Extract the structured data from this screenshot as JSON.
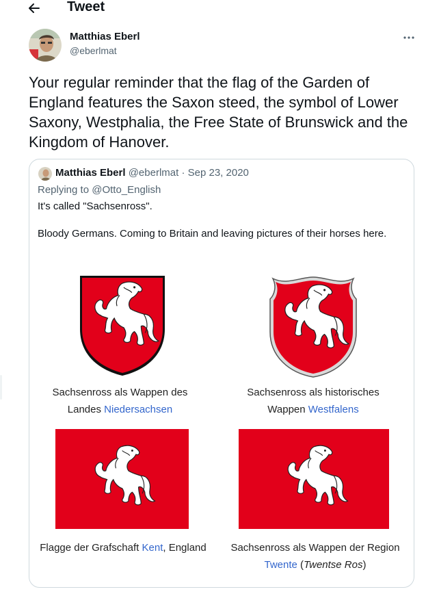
{
  "header": {
    "title": "Tweet"
  },
  "tweet": {
    "author": "Matthias Eberl",
    "handle": "@eberlmat",
    "text": "Your regular reminder that the flag of the Garden of England features the Saxon steed, the symbol of Lower Saxony, Westphalia, the Free State of Brunswick and the Kingdom of Hanover."
  },
  "quote": {
    "author": "Matthias Eberl",
    "handle": "@eberlmat",
    "separator": "·",
    "date": "Sep 23, 2020",
    "replying_to": "Replying to @Otto_English",
    "line1": "It's called \"Sachsenross\".",
    "line2": "Bloody Germans. Coming to Britain and leaving pictures of their horses here.",
    "captions": {
      "c1_a": "Sachsenross als Wappen des",
      "c1_b": "Landes ",
      "c1_link": "Niedersachsen",
      "c2_a": "Sachsenross als historisches",
      "c2_b": "Wappen ",
      "c2_link": "Westfalens",
      "c3_a": "Flagge der Grafschaft ",
      "c3_link": "Kent",
      "c3_b": ", England",
      "c4_a": "Sachsenross als Wappen der Region",
      "c4_link": "Twente",
      "c4_b": " (",
      "c4_ital": "Twentse Ros",
      "c4_c": ")"
    }
  },
  "colors": {
    "flag_red": "#e2001a",
    "link": "#3366cc",
    "muted": "#536471",
    "border": "#cfd9de"
  },
  "icons": [
    "back-arrow-icon",
    "more-dots-icon"
  ]
}
